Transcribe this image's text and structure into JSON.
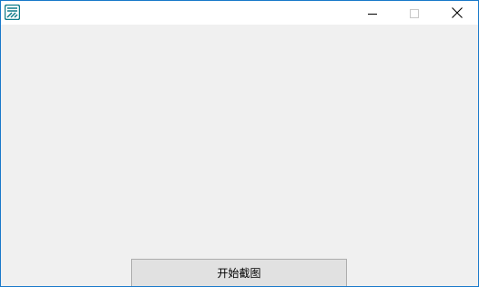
{
  "window": {
    "app_icon": "app-logo-icon",
    "controls": {
      "minimize_icon": "minimize-icon",
      "maximize_icon": "maximize-icon",
      "close_icon": "close-icon"
    },
    "colors": {
      "border": "#1979ca",
      "icon_accent": "#0f7c8a",
      "client_bg": "#f0f0f0",
      "button_bg": "#e1e1e1"
    }
  },
  "main": {
    "start_capture_label": "开始截图"
  }
}
